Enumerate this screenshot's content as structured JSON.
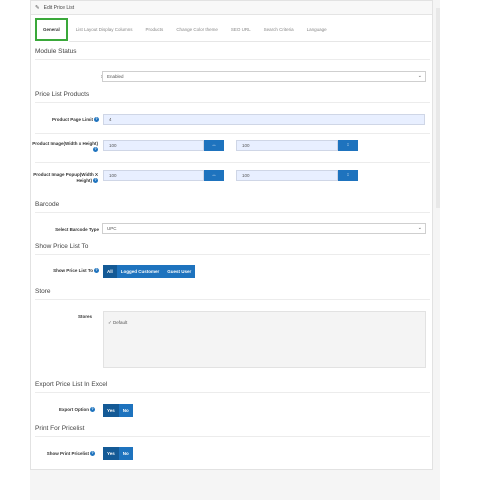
{
  "header": {
    "title": "Edit Price List",
    "icon": "pencil-icon"
  },
  "tabs": [
    {
      "label": "General",
      "active": true
    },
    {
      "label": "List Layout Display Columns",
      "active": false
    },
    {
      "label": "Products",
      "active": false
    },
    {
      "label": "Change Color theme",
      "active": false
    },
    {
      "label": "SEO URL",
      "active": false
    },
    {
      "label": "Search Criteria",
      "active": false
    },
    {
      "label": "Language",
      "active": false
    }
  ],
  "module_status": {
    "title": "Module Status",
    "status_label": "Status",
    "status_value": "Enabled"
  },
  "products": {
    "title": "Price List Products",
    "limit_label": "Product Page Limit",
    "limit_value": "4",
    "image_label": "Product Image(Width x Height)",
    "image_width": "100",
    "image_height": "100",
    "popup_label": "Product Image Popup(Width X Height)",
    "popup_width": "100",
    "popup_height": "100",
    "width_icon": "↔",
    "height_icon": "↕"
  },
  "barcode": {
    "title": "Barcode",
    "type_label": "Select Barcode Type",
    "type_value": "UPC"
  },
  "show_to": {
    "title": "Show Price List To",
    "label": "Show Price List To",
    "options": [
      "All",
      "Logged Customer",
      "Guest User"
    ],
    "selected": "All"
  },
  "store": {
    "title": "Store",
    "label": "Stores",
    "items": [
      "Default"
    ]
  },
  "export": {
    "title": "Export Price List In Excel",
    "label": "Export Option",
    "yes": "Yes",
    "no": "No",
    "selected": "Yes"
  },
  "print": {
    "title": "Print For Pricelist",
    "label": "Show Print Pricelist",
    "yes": "Yes",
    "no": "No",
    "selected": "Yes"
  },
  "colors": {
    "accent": "#1e73be",
    "active_tab_border": "#3aa83a",
    "input_bg": "#e8efff"
  }
}
